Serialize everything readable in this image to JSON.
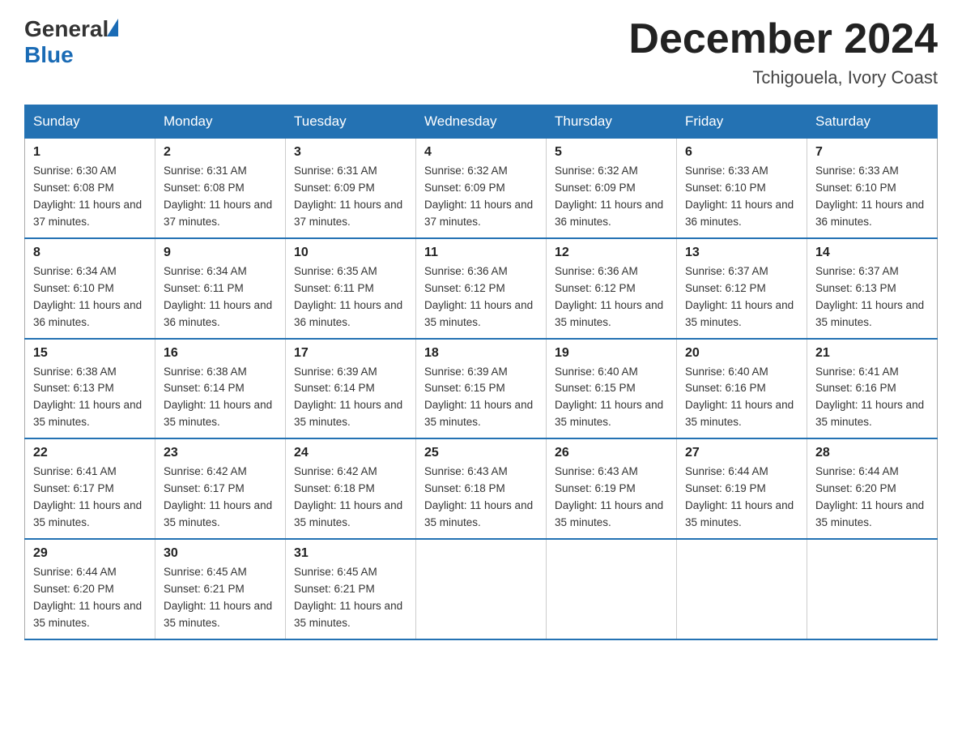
{
  "header": {
    "logo_general": "General",
    "logo_blue": "Blue",
    "month_title": "December 2024",
    "location": "Tchigouela, Ivory Coast"
  },
  "days_of_week": [
    "Sunday",
    "Monday",
    "Tuesday",
    "Wednesday",
    "Thursday",
    "Friday",
    "Saturday"
  ],
  "weeks": [
    [
      {
        "day": "1",
        "sunrise": "6:30 AM",
        "sunset": "6:08 PM",
        "daylight": "11 hours and 37 minutes."
      },
      {
        "day": "2",
        "sunrise": "6:31 AM",
        "sunset": "6:08 PM",
        "daylight": "11 hours and 37 minutes."
      },
      {
        "day": "3",
        "sunrise": "6:31 AM",
        "sunset": "6:09 PM",
        "daylight": "11 hours and 37 minutes."
      },
      {
        "day": "4",
        "sunrise": "6:32 AM",
        "sunset": "6:09 PM",
        "daylight": "11 hours and 37 minutes."
      },
      {
        "day": "5",
        "sunrise": "6:32 AM",
        "sunset": "6:09 PM",
        "daylight": "11 hours and 36 minutes."
      },
      {
        "day": "6",
        "sunrise": "6:33 AM",
        "sunset": "6:10 PM",
        "daylight": "11 hours and 36 minutes."
      },
      {
        "day": "7",
        "sunrise": "6:33 AM",
        "sunset": "6:10 PM",
        "daylight": "11 hours and 36 minutes."
      }
    ],
    [
      {
        "day": "8",
        "sunrise": "6:34 AM",
        "sunset": "6:10 PM",
        "daylight": "11 hours and 36 minutes."
      },
      {
        "day": "9",
        "sunrise": "6:34 AM",
        "sunset": "6:11 PM",
        "daylight": "11 hours and 36 minutes."
      },
      {
        "day": "10",
        "sunrise": "6:35 AM",
        "sunset": "6:11 PM",
        "daylight": "11 hours and 36 minutes."
      },
      {
        "day": "11",
        "sunrise": "6:36 AM",
        "sunset": "6:12 PM",
        "daylight": "11 hours and 35 minutes."
      },
      {
        "day": "12",
        "sunrise": "6:36 AM",
        "sunset": "6:12 PM",
        "daylight": "11 hours and 35 minutes."
      },
      {
        "day": "13",
        "sunrise": "6:37 AM",
        "sunset": "6:12 PM",
        "daylight": "11 hours and 35 minutes."
      },
      {
        "day": "14",
        "sunrise": "6:37 AM",
        "sunset": "6:13 PM",
        "daylight": "11 hours and 35 minutes."
      }
    ],
    [
      {
        "day": "15",
        "sunrise": "6:38 AM",
        "sunset": "6:13 PM",
        "daylight": "11 hours and 35 minutes."
      },
      {
        "day": "16",
        "sunrise": "6:38 AM",
        "sunset": "6:14 PM",
        "daylight": "11 hours and 35 minutes."
      },
      {
        "day": "17",
        "sunrise": "6:39 AM",
        "sunset": "6:14 PM",
        "daylight": "11 hours and 35 minutes."
      },
      {
        "day": "18",
        "sunrise": "6:39 AM",
        "sunset": "6:15 PM",
        "daylight": "11 hours and 35 minutes."
      },
      {
        "day": "19",
        "sunrise": "6:40 AM",
        "sunset": "6:15 PM",
        "daylight": "11 hours and 35 minutes."
      },
      {
        "day": "20",
        "sunrise": "6:40 AM",
        "sunset": "6:16 PM",
        "daylight": "11 hours and 35 minutes."
      },
      {
        "day": "21",
        "sunrise": "6:41 AM",
        "sunset": "6:16 PM",
        "daylight": "11 hours and 35 minutes."
      }
    ],
    [
      {
        "day": "22",
        "sunrise": "6:41 AM",
        "sunset": "6:17 PM",
        "daylight": "11 hours and 35 minutes."
      },
      {
        "day": "23",
        "sunrise": "6:42 AM",
        "sunset": "6:17 PM",
        "daylight": "11 hours and 35 minutes."
      },
      {
        "day": "24",
        "sunrise": "6:42 AM",
        "sunset": "6:18 PM",
        "daylight": "11 hours and 35 minutes."
      },
      {
        "day": "25",
        "sunrise": "6:43 AM",
        "sunset": "6:18 PM",
        "daylight": "11 hours and 35 minutes."
      },
      {
        "day": "26",
        "sunrise": "6:43 AM",
        "sunset": "6:19 PM",
        "daylight": "11 hours and 35 minutes."
      },
      {
        "day": "27",
        "sunrise": "6:44 AM",
        "sunset": "6:19 PM",
        "daylight": "11 hours and 35 minutes."
      },
      {
        "day": "28",
        "sunrise": "6:44 AM",
        "sunset": "6:20 PM",
        "daylight": "11 hours and 35 minutes."
      }
    ],
    [
      {
        "day": "29",
        "sunrise": "6:44 AM",
        "sunset": "6:20 PM",
        "daylight": "11 hours and 35 minutes."
      },
      {
        "day": "30",
        "sunrise": "6:45 AM",
        "sunset": "6:21 PM",
        "daylight": "11 hours and 35 minutes."
      },
      {
        "day": "31",
        "sunrise": "6:45 AM",
        "sunset": "6:21 PM",
        "daylight": "11 hours and 35 minutes."
      },
      null,
      null,
      null,
      null
    ]
  ]
}
